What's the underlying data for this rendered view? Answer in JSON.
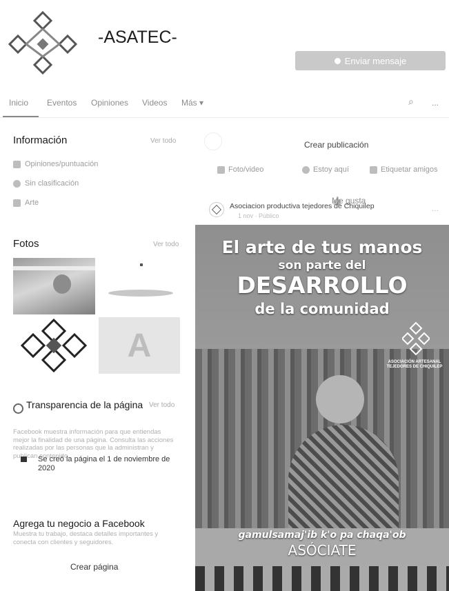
{
  "page": {
    "name": "-ASATEC-",
    "message_button": "Enviar mensaje"
  },
  "nav": {
    "tabs": [
      "Inicio",
      "Eventos",
      "Opiniones",
      "Videos",
      "Más ▾"
    ],
    "like": "Me gusta",
    "more": "..."
  },
  "info": {
    "title": "Información",
    "see_all": "Ver todo",
    "rows": [
      "Opiniones/puntuación",
      "Sin clasificación",
      "Arte"
    ]
  },
  "photos": {
    "title": "Fotos",
    "see_all": "Ver todo",
    "tile_letter": "A"
  },
  "transparency": {
    "title": "Transparencia de la página",
    "see_all": "Ver todo",
    "description": "Facebook muestra información para que entiendas mejor la finalidad de una página. Consulta las acciones realizadas por las personas que la administran y publican contenido.",
    "created": "Se creó la página el 1 de noviembre de 2020"
  },
  "business": {
    "title": "Agrega tu negocio a Facebook",
    "description": "Muestra tu trabajo, destaca detalles importantes y conecta con clientes y seguidores.",
    "create_button": "Crear página"
  },
  "composer": {
    "title": "Crear publicación",
    "actions": [
      "Foto/video",
      "Estoy aquí",
      "Etiquetar amigos"
    ]
  },
  "post": {
    "author": "Asociacion productiva tejedores de Chiquilep",
    "meta": "1 nov · Público",
    "menu": "···"
  },
  "poster": {
    "line1": "El arte de tus manos",
    "line2": "son parte del",
    "line3": "DESARROLLO",
    "line4": "de la comunidad",
    "org": "ASOCIACIÓN ARTESANAL TEJEDORES DE CHIQUILEP",
    "slogan": "gamulsamaj'ib k'o pa chaqa'ob",
    "cta": "ASÓCIATE"
  },
  "colors": {
    "accent": "#c9c9c9",
    "logo_primary": "#6a6a6a"
  }
}
